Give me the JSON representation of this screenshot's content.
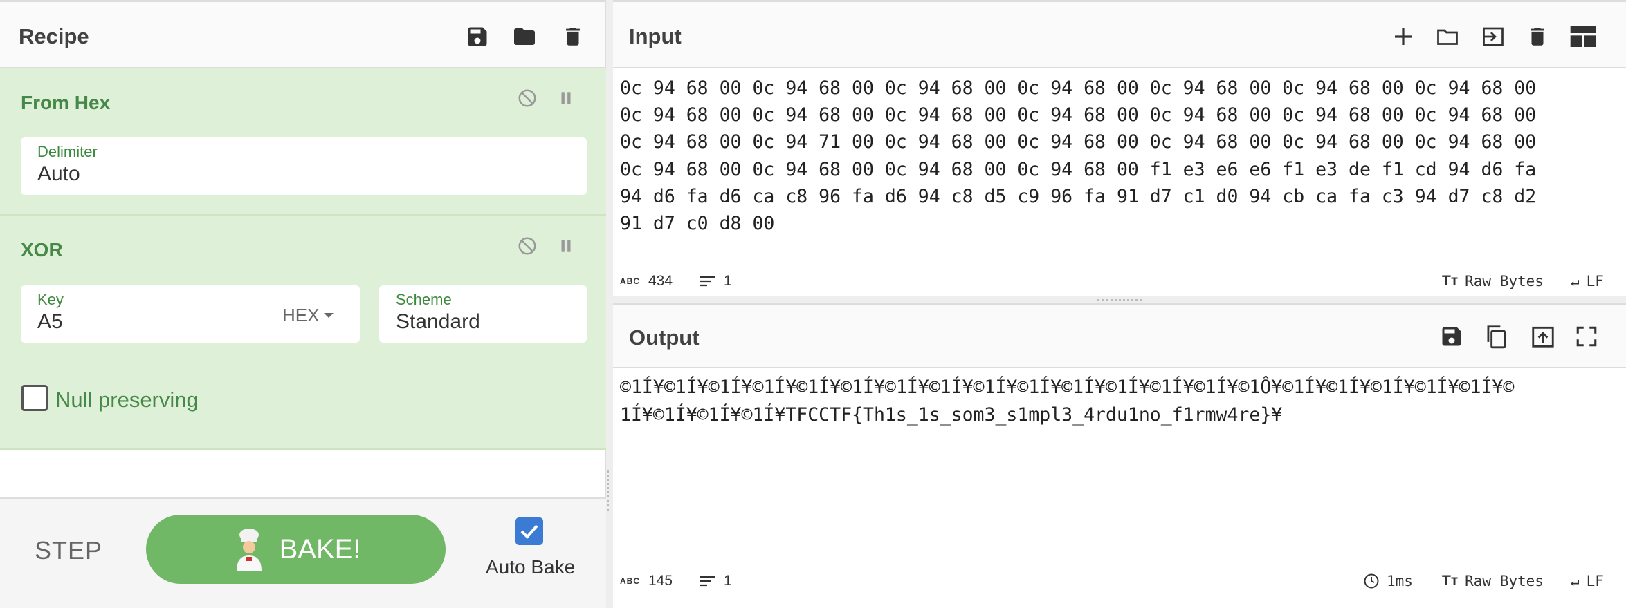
{
  "recipe": {
    "title": "Recipe",
    "icons": [
      "save-icon",
      "folder-icon",
      "trash-icon"
    ],
    "operations": [
      {
        "name": "From Hex",
        "fields": [
          {
            "label": "Delimiter",
            "value": "Auto"
          }
        ]
      },
      {
        "name": "XOR",
        "fields": [
          {
            "label": "Key",
            "value": "A5",
            "format": "HEX"
          },
          {
            "label": "Scheme",
            "value": "Standard"
          }
        ],
        "checkbox": {
          "label": "Null preserving",
          "checked": false
        }
      }
    ]
  },
  "controls": {
    "step_label": "STEP",
    "bake_label": "BAKE!",
    "auto_bake_label": "Auto Bake",
    "auto_bake_checked": true
  },
  "input": {
    "title": "Input",
    "text": "0c 94 68 00 0c 94 68 00 0c 94 68 00 0c 94 68 00 0c 94 68 00 0c 94 68 00 0c 94 68 00\n0c 94 68 00 0c 94 68 00 0c 94 68 00 0c 94 68 00 0c 94 68 00 0c 94 68 00 0c 94 68 00\n0c 94 68 00 0c 94 71 00 0c 94 68 00 0c 94 68 00 0c 94 68 00 0c 94 68 00 0c 94 68 00\n0c 94 68 00 0c 94 68 00 0c 94 68 00 0c 94 68 00 f1 e3 e6 e6 f1 e3 de f1 cd 94 d6 fa\n94 d6 fa d6 ca c8 96 fa d6 94 c8 d5 c9 96 fa 91 d7 c1 d0 94 cb ca fa c3 94 d7 c8 d2\n91 d7 c0 d8 00",
    "status": {
      "length": "434",
      "lines": "1",
      "encoding": "Raw Bytes",
      "eol": "LF"
    }
  },
  "output": {
    "title": "Output",
    "text": "©1Í¥©1Í¥©1Í¥©1Í¥©1Í¥©1Í¥©1Í¥©1Í¥©1Í¥©1Í¥©1Í¥©1Í¥©1Í¥©1Í¥©1Ô¥©1Í¥©1Í¥©1Í¥©1Í¥©1Í¥©\n1Í¥©1Í¥©1Í¥©1Í¥TFCCTF{Th1s_1s_som3_s1mpl3_4rdu1no_f1rmw4re}¥",
    "status": {
      "length": "145",
      "lines": "1",
      "time": "1ms",
      "encoding": "Raw Bytes",
      "eol": "LF"
    }
  }
}
